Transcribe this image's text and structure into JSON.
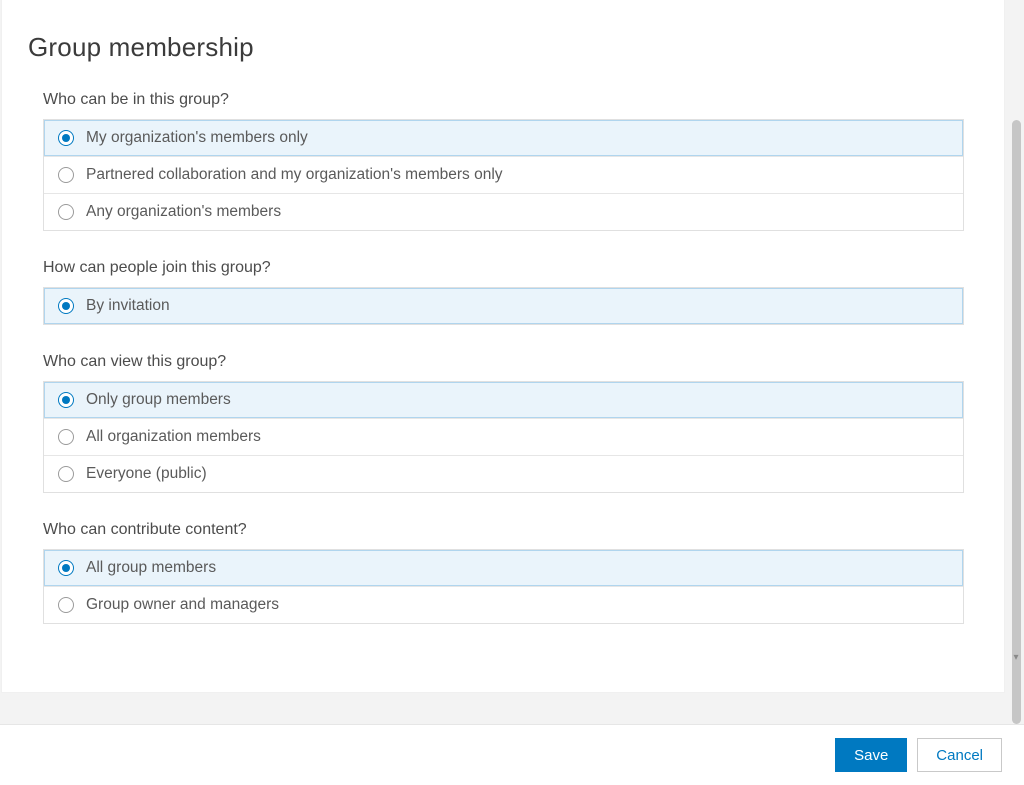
{
  "title": "Group membership",
  "footer": {
    "save": "Save",
    "cancel": "Cancel"
  },
  "fields": [
    {
      "id": "who-can-be",
      "label": "Who can be in this group?",
      "selected": 0,
      "options": [
        "My organization's members only",
        "Partnered collaboration and my organization's members only",
        "Any organization's members"
      ]
    },
    {
      "id": "how-join",
      "label": "How can people join this group?",
      "selected": 0,
      "options": [
        "By invitation"
      ]
    },
    {
      "id": "who-view",
      "label": "Who can view this group?",
      "selected": 0,
      "options": [
        "Only group members",
        "All organization members",
        "Everyone (public)"
      ]
    },
    {
      "id": "who-contribute",
      "label": "Who can contribute content?",
      "selected": 0,
      "options": [
        "All group members",
        "Group owner and managers"
      ]
    }
  ]
}
